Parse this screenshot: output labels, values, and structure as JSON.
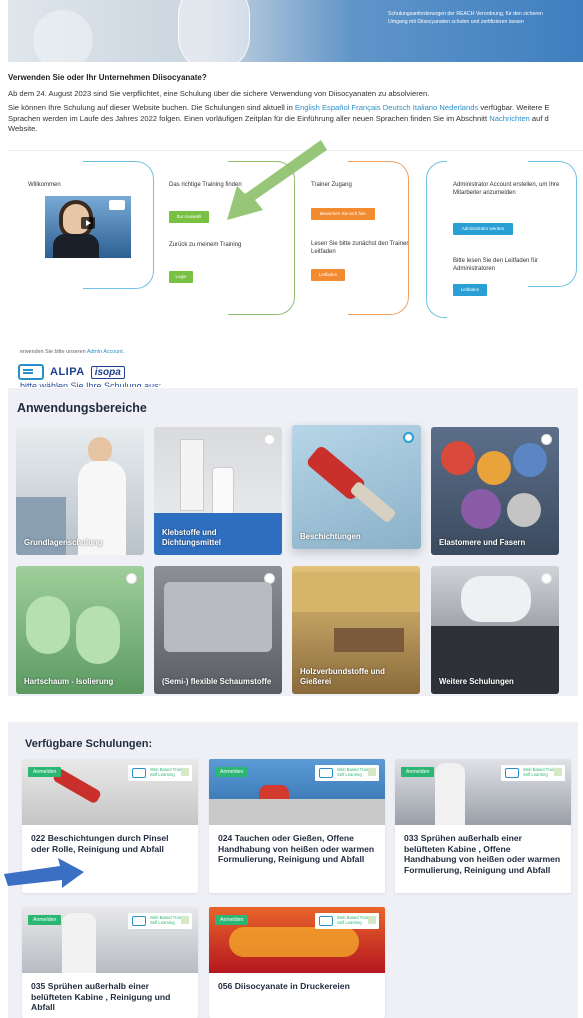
{
  "hero": {
    "caption": "Schulungsanforderungen der REACH Verordnung, für den sicheren Umgang mit Diisocyanaten schulen und zertifizieren lassen"
  },
  "intro": {
    "heading": "Verwenden Sie oder Ihr Unternehmen Diisocyanate?",
    "line1": "Ab dem 24. August 2023 sind Sie verpflichtet, eine Schulung über die sichere Verwendung von Diisocyanaten zu absolvieren.",
    "line2_a": "Sie können Ihre Schulung auf dieser Website buchen. Die Schulungen sind aktuell in ",
    "languages": [
      "English",
      "Español",
      "Français",
      "Deutsch",
      "Italiano",
      "Nederlands"
    ],
    "line2_b": " verfügbar. Weitere E",
    "line3_a": "Sprachen werden im Laufe des Jahres 2022 folgen. Einen vorläufigen Zeitplan für die Einführung aller neuen Sprachen finden Sie im Abschnitt ",
    "line3_link": "Nachrichten",
    "line3_b": " auf d",
    "line4": "Website."
  },
  "panel": {
    "welcome": "Willkommen",
    "col2_title": "Das richtige Training finden",
    "col2_btn": "Zur Auswahl",
    "col2_sub": "Zurück zu meinem Training",
    "col2_btn2": "Login",
    "col3_title": "Trainer Zugang",
    "col3_btn": "Bewerben Sie sich hier",
    "col3_sub": "Lesen Sie bitte zunächst den Trainer Leitfaden",
    "col3_btn2": "Leitfaden",
    "col4_title": "Administrator Account erstellen, um Ihre Mitarbeiter anzumelden",
    "col4_btn": "Administrator werden",
    "col4_sub": "Bitte lesen Sie den Leitfaden für Administratoren",
    "col4_btn2": "Leitfaden"
  },
  "mid": {
    "strip_text": "erwenden Sie bitte unseren ",
    "strip_link": "Admin Account.",
    "brand1": "ALIPA",
    "brand2": "isopa",
    "cut_text": "bitte wählen Sie Ihre Schulung aus:"
  },
  "areas": {
    "title": "Anwendungsbereiche",
    "tiles": [
      {
        "label": "Grundlagenschulung",
        "selected": false
      },
      {
        "label": "Klebstoffe und Dichtungsmittel",
        "selected": false
      },
      {
        "label": "Beschichtungen",
        "selected": true
      },
      {
        "label": "Elastomere und Fasern",
        "selected": false
      },
      {
        "label": "Hartschaum - Isolierung",
        "selected": false
      },
      {
        "label": "(Semi-) flexible Schaumstoffe",
        "selected": false
      },
      {
        "label": "Holzverbundstoffe und Gießerei",
        "selected": false
      },
      {
        "label": "Weitere Schulungen",
        "selected": false
      }
    ]
  },
  "courses": {
    "title": "Verfügbare Schulungen:",
    "badge": "Anmelden",
    "wbt": "Web Based Training Self Learning",
    "items": [
      {
        "title": "022 Beschichtungen durch Pinsel oder Rolle, Reinigung und Abfall"
      },
      {
        "title": "024 Tauchen oder Gießen, Offene Handhabung von heißen oder warmen Formulierung, Reinigung und Abfall"
      },
      {
        "title": "033 Sprühen außerhalb einer belüfteten Kabine , Offene Handhabung von heißen oder warmen Formulierung, Reinigung und Abfall"
      },
      {
        "title": "035 Sprühen außerhalb einer belüfteten Kabine , Reinigung und Abfall"
      },
      {
        "title": "056 Diisocyanate in Druckereien"
      }
    ]
  },
  "colors": {
    "link": "#2a8fc9",
    "green_btn": "#79c142",
    "orange_btn": "#f28a30",
    "blue_btn": "#2a9fd6",
    "badge_green": "#2bb673",
    "arrow_green": "#8cc06a",
    "arrow_blue": "#3a6fc4"
  }
}
